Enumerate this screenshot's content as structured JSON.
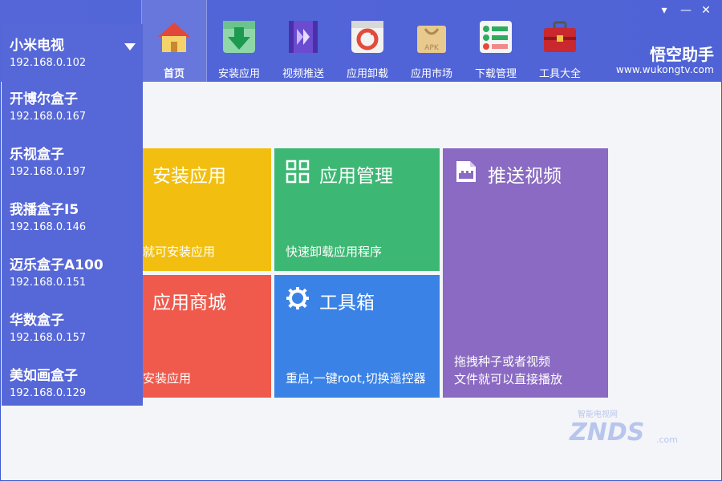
{
  "window": {
    "collapse_glyph": "▾",
    "minimize_glyph": "—",
    "close_glyph": "✕"
  },
  "brand": {
    "title": "悟空助手",
    "url": "www.wukongtv.com"
  },
  "nav": [
    {
      "label": "首页",
      "icon": "home-icon",
      "active": true
    },
    {
      "label": "安装应用",
      "icon": "install-download-icon"
    },
    {
      "label": "视频推送",
      "icon": "video-push-icon"
    },
    {
      "label": "应用卸载",
      "icon": "uninstall-icon"
    },
    {
      "label": "应用市场",
      "icon": "apk-bag-icon"
    },
    {
      "label": "下载管理",
      "icon": "download-manage-icon"
    },
    {
      "label": "工具大全",
      "icon": "toolbox-icon"
    }
  ],
  "devices": [
    {
      "name": "小米电视",
      "ip": "192.168.0.102"
    },
    {
      "name": "开博尔盒子",
      "ip": "192.168.0.167"
    },
    {
      "name": "乐视盒子",
      "ip": "192.168.0.197"
    },
    {
      "name": "我播盒子I5",
      "ip": "192.168.0.146"
    },
    {
      "name": "迈乐盒子A100",
      "ip": "192.168.0.151"
    },
    {
      "name": "华数盒子",
      "ip": "192.168.0.157"
    },
    {
      "name": "美如画盒子",
      "ip": "192.168.0.129"
    }
  ],
  "tiles": {
    "install": {
      "title": "安装应用",
      "desc": "就可安装应用",
      "color": "#f2bf10"
    },
    "app_manage": {
      "title": "应用管理",
      "desc": "快速卸载应用程序",
      "color": "#3db874"
    },
    "push_video": {
      "title": "推送视频",
      "desc_line1": "拖拽种子或者视频",
      "desc_line2": "文件就可以直接播放",
      "color": "#8a6ac2"
    },
    "store": {
      "title": "应用商城",
      "desc": "安装应用",
      "color": "#ef5a4c"
    },
    "toolbox": {
      "title": "工具箱",
      "desc": "重启,一键root,切换遥控器",
      "color": "#3a82e6"
    }
  },
  "watermark": {
    "text": "ZNDS",
    "sub": "智能电视网",
    "suffix": ".com"
  }
}
